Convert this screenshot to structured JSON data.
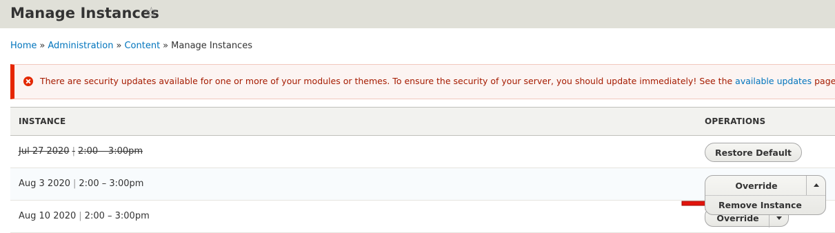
{
  "header": {
    "title": "Manage Instances",
    "star_icon": "star-outline-icon"
  },
  "breadcrumb": {
    "items": [
      "Home",
      "Administration",
      "Content"
    ],
    "separator": "»",
    "current": "Manage Instances"
  },
  "message": {
    "icon": "error-circle-icon",
    "text": "There are security updates available for one or more of your modules or themes. To ensure the security of your server, you should update immediately! See the",
    "link_text": "available updates",
    "trailing": "page"
  },
  "table": {
    "headers": {
      "instance": "INSTANCE",
      "operations": "OPERATIONS"
    },
    "rows": [
      {
        "date": "Jul 27 2020",
        "time": "2:00 – 3:00pm",
        "struck": true,
        "operation": "Restore Default"
      },
      {
        "date": "Aug 3 2020",
        "time": "2:00 – 3:00pm",
        "struck": false,
        "operation": "Override",
        "menu_open": true,
        "menu_items": [
          "Remove Instance"
        ]
      },
      {
        "date": "Aug 10 2020",
        "time": "2:00 – 3:00pm",
        "struck": false,
        "operation": "Override"
      }
    ],
    "pipe": "|"
  },
  "colors": {
    "header_bg": "#e0e0d8",
    "link": "#0074bd",
    "error_text": "#a51b00",
    "error_border": "#e62600",
    "arrow": "#e2140c"
  }
}
